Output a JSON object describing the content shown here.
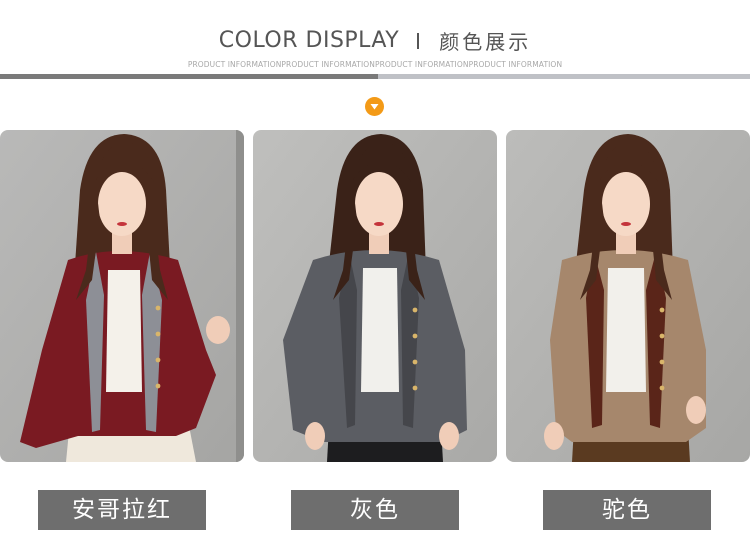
{
  "header": {
    "title_en": "COLOR DISPLAY",
    "title_cn": "颜色展示",
    "subtitle": "PRODUCT INFORMATIONPRODUCT INFORMATIONPRODUCT INFORMATIONPRODUCT INFORMATION"
  },
  "colors": {
    "rule_dark": "#7a7a7a",
    "rule_light": "#bfc1c6",
    "arrow_badge": "#f39a17",
    "label_bg": "#6e6e6e"
  },
  "products": [
    {
      "color_name": "安哥拉红",
      "cardigan_color": "#7a1a22",
      "hood_color": "#8d8f96"
    },
    {
      "color_name": "灰色",
      "cardigan_color": "#5b5d63",
      "hood_color": "#45464b"
    },
    {
      "color_name": "驼色",
      "cardigan_color": "#a6876c",
      "hood_color": "#5a2519"
    }
  ]
}
